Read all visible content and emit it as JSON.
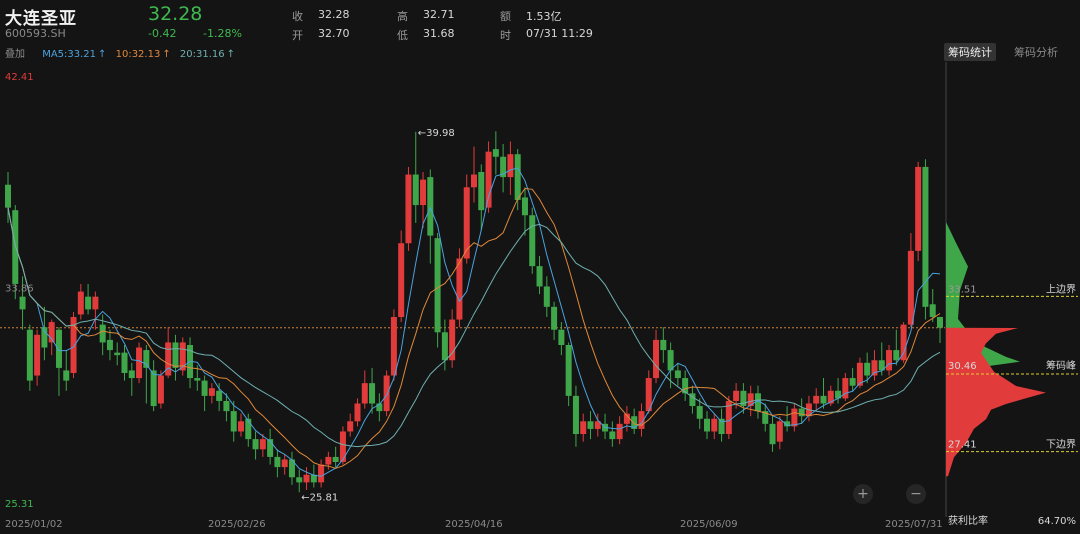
{
  "header": {
    "name": "大连圣亚",
    "code": "600593.SH",
    "price": "32.28",
    "change": "-0.42",
    "change_pct": "-1.28%",
    "fields": [
      {
        "label": "收",
        "value": "32.28"
      },
      {
        "label": "开",
        "value": "32.70"
      },
      {
        "label": "高",
        "value": "32.71"
      },
      {
        "label": "低",
        "value": "31.68"
      },
      {
        "label": "额",
        "value": "1.53亿"
      },
      {
        "label": "时",
        "value": "07/31 11:29"
      }
    ]
  },
  "ma": {
    "overlay": "叠加",
    "ma5": "MA5:33.21",
    "ma10": "10:32.13",
    "ma20": "20:31.16",
    "arrow": "↑"
  },
  "tabs": {
    "chip_stats": "筹码统计",
    "chip_analysis": "筹码分析"
  },
  "axis": {
    "y_top": "42.41",
    "y_mid": "33.86",
    "y_bottom": "25.31",
    "dates": [
      "2025/01/02",
      "2025/02/26",
      "2025/04/16",
      "2025/06/09",
      "2025/07/31"
    ]
  },
  "annotations": {
    "high": "39.98",
    "low": "25.81",
    "arrow_left": "←"
  },
  "chip": {
    "upper_label": "上边界",
    "upper_value": "33.51",
    "peak_label": "筹码峰",
    "peak_value": "30.46",
    "lower_label": "下边界",
    "lower_value": "27.41",
    "profit_label": "获利比率",
    "profit_value": "64.70%"
  },
  "controls": {
    "zoom_in": "+",
    "zoom_out": "−"
  },
  "colors": {
    "up": "#e23b3b",
    "down": "#3fa74a",
    "ma5": "#4aa3df",
    "ma10": "#e0883a",
    "ma20": "#6fb0b0",
    "chip_up": "#3fa74a",
    "chip_down": "#e23b3b",
    "boundary": "#d8d030"
  },
  "chart_data": {
    "type": "candlestick",
    "ylim": [
      25.31,
      42.41
    ],
    "x_ticks": [
      "2025/01/02",
      "2025/02/26",
      "2025/04/16",
      "2025/06/09",
      "2025/07/31"
    ],
    "marked_high": 39.98,
    "marked_low": 25.81,
    "current": 32.28,
    "series": [
      {
        "name": "MA5",
        "value": 33.21
      },
      {
        "name": "10",
        "value": 32.13
      },
      {
        "name": "20",
        "value": 31.16
      }
    ],
    "candles": [
      [
        37.9,
        37.0,
        38.4,
        36.4
      ],
      [
        36.9,
        34.0,
        37.1,
        33.4
      ],
      [
        33.5,
        33.0,
        34.3,
        32.2
      ],
      [
        32.2,
        30.2,
        32.4,
        29.8
      ],
      [
        30.4,
        32.0,
        32.2,
        30.0
      ],
      [
        32.3,
        31.5,
        33.1,
        31.0
      ],
      [
        31.7,
        32.5,
        32.6,
        31.2
      ],
      [
        32.2,
        30.7,
        32.3,
        29.6
      ],
      [
        30.6,
        30.2,
        31.4,
        29.8
      ],
      [
        30.5,
        32.7,
        32.9,
        30.3
      ],
      [
        32.8,
        33.7,
        34.0,
        32.6
      ],
      [
        33.5,
        33.0,
        34.0,
        32.8
      ],
      [
        33.0,
        33.5,
        33.7,
        32.2
      ],
      [
        32.4,
        31.7,
        32.8,
        31.2
      ],
      [
        31.8,
        31.4,
        32.2,
        31.0
      ],
      [
        31.3,
        31.2,
        31.7,
        30.8
      ],
      [
        31.3,
        30.5,
        31.6,
        30.2
      ],
      [
        30.6,
        30.3,
        30.9,
        29.6
      ],
      [
        30.3,
        31.5,
        31.7,
        30.1
      ],
      [
        31.4,
        30.7,
        31.6,
        29.3
      ],
      [
        30.6,
        29.2,
        31.0,
        29.0
      ],
      [
        29.3,
        30.4,
        30.6,
        29.1
      ],
      [
        30.4,
        31.7,
        32.3,
        30.3
      ],
      [
        31.7,
        30.7,
        32.0,
        30.2
      ],
      [
        30.6,
        31.7,
        31.9,
        30.4
      ],
      [
        31.6,
        30.3,
        31.9,
        29.9
      ],
      [
        30.3,
        30.2,
        30.8,
        29.8
      ],
      [
        30.2,
        29.6,
        30.4,
        29.0
      ],
      [
        29.6,
        29.9,
        30.1,
        29.3
      ],
      [
        29.8,
        29.4,
        30.1,
        29.0
      ],
      [
        29.4,
        29.0,
        29.7,
        28.6
      ],
      [
        29.0,
        28.2,
        29.4,
        27.8
      ],
      [
        28.2,
        28.6,
        28.9,
        28.0
      ],
      [
        28.7,
        27.9,
        28.9,
        27.6
      ],
      [
        27.9,
        27.5,
        28.2,
        27.1
      ],
      [
        27.5,
        27.9,
        28.1,
        27.2
      ],
      [
        27.9,
        27.2,
        28.3,
        26.9
      ],
      [
        27.2,
        26.8,
        27.5,
        26.4
      ],
      [
        26.8,
        27.1,
        27.3,
        26.5
      ],
      [
        27.1,
        26.4,
        27.4,
        26.1
      ],
      [
        26.4,
        26.2,
        26.7,
        25.81
      ],
      [
        26.2,
        26.5,
        26.8,
        25.9
      ],
      [
        26.5,
        26.2,
        26.9,
        26.0
      ],
      [
        26.2,
        26.9,
        27.1,
        26.0
      ],
      [
        26.9,
        27.2,
        27.4,
        26.7
      ],
      [
        27.2,
        27.0,
        27.6,
        26.8
      ],
      [
        27.0,
        28.2,
        28.4,
        26.9
      ],
      [
        28.2,
        28.6,
        28.9,
        28.0
      ],
      [
        28.6,
        29.3,
        29.5,
        28.4
      ],
      [
        29.3,
        30.1,
        30.6,
        29.1
      ],
      [
        30.1,
        29.3,
        30.7,
        28.9
      ],
      [
        29.3,
        29.0,
        29.7,
        28.6
      ],
      [
        29.0,
        30.4,
        30.6,
        28.8
      ],
      [
        30.4,
        32.7,
        33.0,
        30.2
      ],
      [
        32.7,
        35.6,
        36.1,
        32.5
      ],
      [
        35.6,
        38.3,
        38.6,
        35.3
      ],
      [
        38.3,
        37.1,
        39.98,
        36.4
      ],
      [
        37.1,
        38.1,
        38.4,
        36.2
      ],
      [
        38.2,
        35.9,
        38.5,
        34.8
      ],
      [
        35.8,
        32.1,
        36.0,
        31.5
      ],
      [
        32.1,
        31.0,
        32.6,
        30.6
      ],
      [
        31.0,
        32.6,
        33.0,
        30.7
      ],
      [
        32.6,
        35.0,
        35.4,
        32.3
      ],
      [
        35.0,
        37.8,
        38.3,
        34.8
      ],
      [
        37.8,
        38.3,
        39.4,
        37.2
      ],
      [
        38.4,
        36.9,
        38.7,
        36.1
      ],
      [
        37.0,
        39.2,
        39.6,
        36.8
      ],
      [
        39.3,
        39.0,
        40.0,
        38.3
      ],
      [
        39.0,
        38.2,
        39.5,
        37.6
      ],
      [
        38.2,
        39.1,
        39.6,
        37.5
      ],
      [
        39.1,
        37.3,
        39.3,
        36.9
      ],
      [
        37.4,
        36.7,
        37.8,
        35.9
      ],
      [
        36.7,
        34.7,
        37.0,
        34.4
      ],
      [
        34.7,
        33.9,
        35.1,
        33.6
      ],
      [
        33.9,
        33.1,
        34.3,
        32.7
      ],
      [
        33.1,
        32.2,
        33.3,
        31.8
      ],
      [
        32.2,
        31.6,
        32.5,
        31.2
      ],
      [
        31.6,
        29.6,
        31.7,
        29.2
      ],
      [
        29.6,
        28.1,
        30.0,
        27.6
      ],
      [
        28.1,
        28.6,
        28.9,
        27.8
      ],
      [
        28.6,
        28.3,
        29.0,
        27.9
      ],
      [
        28.3,
        28.6,
        28.9,
        28.0
      ],
      [
        28.5,
        28.2,
        28.9,
        27.9
      ],
      [
        28.2,
        27.9,
        28.6,
        27.6
      ],
      [
        27.9,
        28.5,
        28.8,
        27.7
      ],
      [
        28.5,
        28.9,
        29.2,
        28.2
      ],
      [
        28.8,
        28.3,
        29.1,
        28.1
      ],
      [
        28.3,
        29.0,
        29.3,
        28.0
      ],
      [
        29.0,
        30.3,
        30.6,
        28.9
      ],
      [
        30.3,
        31.8,
        32.2,
        30.1
      ],
      [
        31.8,
        31.4,
        32.3,
        30.9
      ],
      [
        31.4,
        30.6,
        31.7,
        29.9
      ],
      [
        30.6,
        30.3,
        30.9,
        30.0
      ],
      [
        30.3,
        29.7,
        30.6,
        29.4
      ],
      [
        29.7,
        29.2,
        30.0,
        28.9
      ],
      [
        29.2,
        28.7,
        29.5,
        28.3
      ],
      [
        28.7,
        28.2,
        29.0,
        27.9
      ],
      [
        28.2,
        28.7,
        28.9,
        27.9
      ],
      [
        28.7,
        28.1,
        29.1,
        27.8
      ],
      [
        28.1,
        29.4,
        29.6,
        27.9
      ],
      [
        29.4,
        29.8,
        30.1,
        29.1
      ],
      [
        29.8,
        29.2,
        30.1,
        28.9
      ],
      [
        29.2,
        29.7,
        30.0,
        28.8
      ],
      [
        29.7,
        29.0,
        30.0,
        28.7
      ],
      [
        29.0,
        28.5,
        29.3,
        28.2
      ],
      [
        28.5,
        27.7,
        28.8,
        27.4
      ],
      [
        27.8,
        28.6,
        28.8,
        27.5
      ],
      [
        28.6,
        28.4,
        29.2,
        28.2
      ],
      [
        28.4,
        29.1,
        29.3,
        28.2
      ],
      [
        29.1,
        28.8,
        29.5,
        28.5
      ],
      [
        28.8,
        29.3,
        29.6,
        28.6
      ],
      [
        29.3,
        29.6,
        29.9,
        29.0
      ],
      [
        29.6,
        29.3,
        30.3,
        29.1
      ],
      [
        29.3,
        29.8,
        30.0,
        29.2
      ],
      [
        29.8,
        29.5,
        30.3,
        29.3
      ],
      [
        29.5,
        30.3,
        30.5,
        29.4
      ],
      [
        30.3,
        30.0,
        30.7,
        29.8
      ],
      [
        30.0,
        30.9,
        31.1,
        29.9
      ],
      [
        30.9,
        30.4,
        31.3,
        30.1
      ],
      [
        30.4,
        31.0,
        31.4,
        30.2
      ],
      [
        31.0,
        30.6,
        31.7,
        30.4
      ],
      [
        30.6,
        31.4,
        31.6,
        30.4
      ],
      [
        31.4,
        31.0,
        32.2,
        30.8
      ],
      [
        31.0,
        32.4,
        32.5,
        30.9
      ],
      [
        32.4,
        35.3,
        36.0,
        32.3
      ],
      [
        35.3,
        38.6,
        38.8,
        34.9
      ],
      [
        38.6,
        33.1,
        38.9,
        32.6
      ],
      [
        33.2,
        32.7,
        33.8,
        32.5
      ],
      [
        32.7,
        32.28,
        32.71,
        31.68
      ]
    ],
    "chip_distribution": {
      "upper": 33.51,
      "peak": 30.46,
      "lower": 27.41,
      "profit_ratio": "64.70%"
    }
  }
}
